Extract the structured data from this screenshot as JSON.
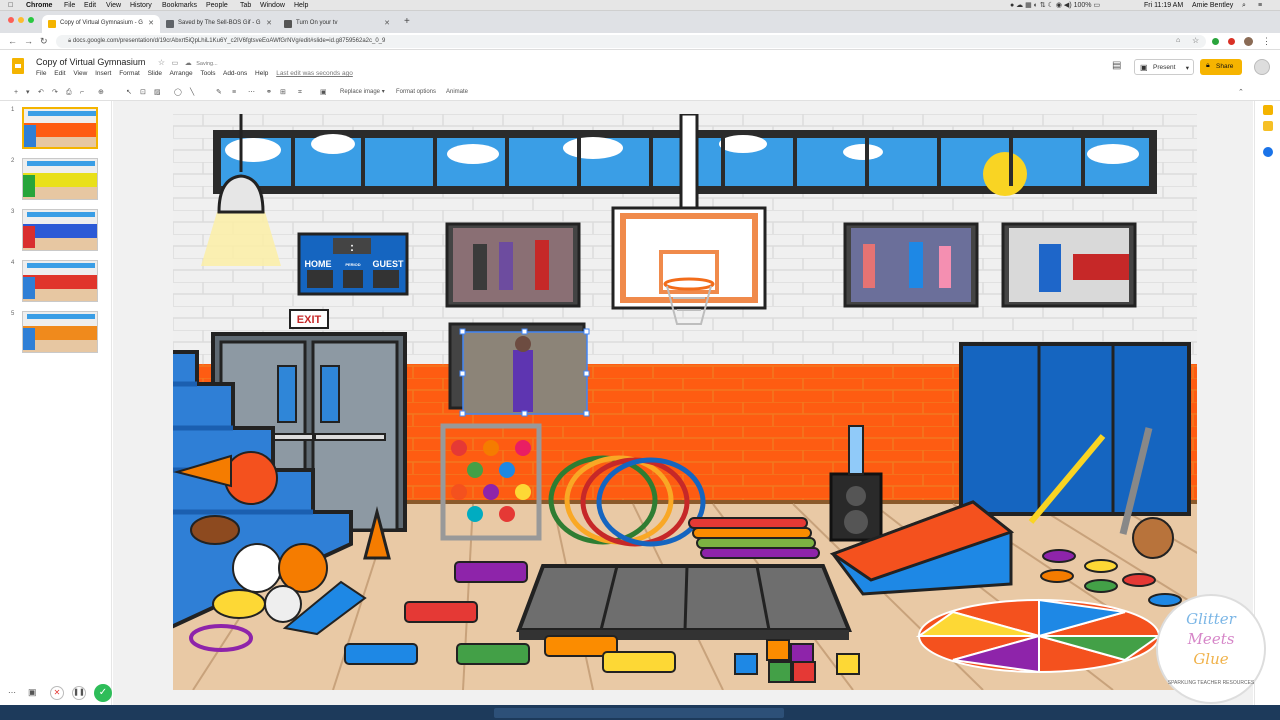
{
  "mac_menubar": {
    "app": "Chrome",
    "items": [
      "File",
      "Edit",
      "View",
      "History",
      "Bookmarks",
      "People",
      "Tab",
      "Window",
      "Help"
    ],
    "clock": "Fri 11:19 AM",
    "user": "Amie Bentley"
  },
  "browser": {
    "tabs": [
      {
        "label": "Copy of Virtual Gymnasium - G",
        "active": true
      },
      {
        "label": "Saved by The Sell-BOS Gif - G",
        "active": false
      },
      {
        "label": "Turn On your tv",
        "active": false
      }
    ],
    "new_tab": "+",
    "url": "docs.google.com/presentation/d/19crAbxrt5iQpLhiL1Ku6Y_c2IV6fgtsveEoAWfGrNVg/edit#slide=id.g8759562a2c_0_9"
  },
  "docs": {
    "title": "Copy of Virtual Gymnasium",
    "saving": "Saving...",
    "menus": [
      "File",
      "Edit",
      "View",
      "Insert",
      "Format",
      "Slide",
      "Arrange",
      "Tools",
      "Add-ons",
      "Help"
    ],
    "last_edit": "Last edit was seconds ago",
    "present_label": "Present",
    "share_label": "Share"
  },
  "toolbar": {
    "replace_image": "Replace image ▾",
    "format_options": "Format options",
    "animate": "Animate"
  },
  "filmstrip": {
    "slides": [
      "1",
      "2",
      "3",
      "4",
      "5"
    ],
    "selected": 1
  },
  "slide": {
    "scoreboard": {
      "home": "HOME",
      "period": "PERIOD",
      "guest": "GUEST",
      "clock": ":"
    },
    "exit_sign": "EXIT"
  },
  "logo": {
    "line1": "Glitter",
    "line2": "Meets",
    "line3": "Glue",
    "tagline": "SPARKLING TEACHER RESOURCES"
  },
  "colors": {
    "accent": "#f4b400",
    "wall_orange": "#fe5c12",
    "bleacher_blue": "#2f7fd6",
    "floor": "#e8c8a4"
  }
}
